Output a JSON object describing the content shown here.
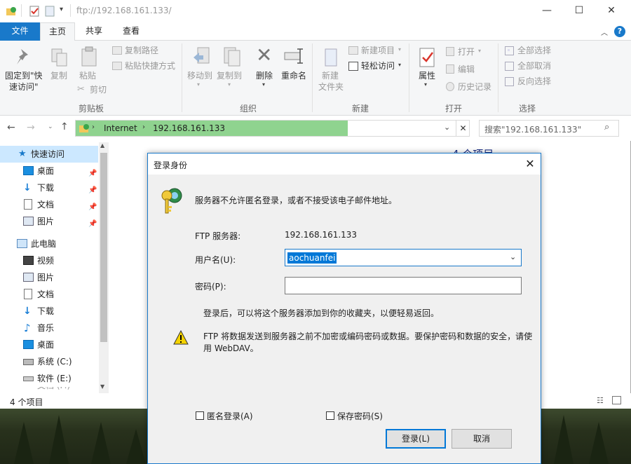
{
  "window": {
    "title": "ftp://192.168.161.133/",
    "minimize": "—",
    "maximize": "☐",
    "close": "✕"
  },
  "ribbon_tabs": [
    "文件",
    "主页",
    "共享",
    "查看"
  ],
  "ribbon": {
    "clipboard": {
      "pin_quick_access": "固定到\"快",
      "pin_quick_access2": "速访问\"",
      "copy": "复制",
      "paste": "粘贴",
      "copy_path": "复制路径",
      "paste_shortcut": "粘贴快捷方式",
      "cut": "剪切",
      "group": "剪贴板"
    },
    "organize": {
      "move_to": "移动到",
      "copy_to": "复制到",
      "delete": "删除",
      "rename": "重命名",
      "group": "组织"
    },
    "new": {
      "new_folder": "新建",
      "new_folder2": "文件夹",
      "new_item": "新建项目",
      "easy_access": "轻松访问",
      "group": "新建"
    },
    "open": {
      "properties": "属性",
      "open": "打开",
      "edit": "编辑",
      "history": "历史记录",
      "group": "打开"
    },
    "select": {
      "select_all": "全部选择",
      "select_none": "全部取消",
      "invert": "反向选择",
      "group": "选择"
    }
  },
  "address": {
    "root": "Internet",
    "host": "192.168.161.133",
    "search_placeholder": "搜索\"192.168.161.133\""
  },
  "nav": {
    "quick_access": "快速访问",
    "quick_items": [
      "桌面",
      "下载",
      "文档",
      "图片"
    ],
    "this_pc": "此电脑",
    "pc_items": [
      "视频",
      "图片",
      "文档",
      "下载",
      "音乐",
      "桌面",
      "系统 (C:)",
      "软件 (E:)"
    ],
    "partial_item": "文档 (F:)"
  },
  "content": {
    "item_count_header": "4 个项目"
  },
  "status": {
    "count": "4 个项目"
  },
  "dialog": {
    "title": "登录身份",
    "message": "服务器不允许匿名登录，或者不接受该电子邮件地址。",
    "ftp_server_label": "FTP 服务器:",
    "ftp_server_value": "192.168.161.133",
    "username_label": "用户名(U):",
    "username_value": "aochuanfei",
    "password_label": "密码(P):",
    "hint": "登录后，可以将这个服务器添加到你的收藏夹，以便轻易返回。",
    "warning_line1": "FTP 将数据发送到服务器之前不加密或编码密码或数据。要保护密码和数据的安全，请使",
    "warning_line2": "用 WebDAV。",
    "anonymous_label": "匿名登录(A)",
    "save_password_label": "保存密码(S)",
    "login_button": "登录(L)",
    "cancel_button": "取消"
  },
  "colors": {
    "accent": "#1979ca",
    "address_fill": "#8fd38f",
    "selection": "#0078d7"
  }
}
